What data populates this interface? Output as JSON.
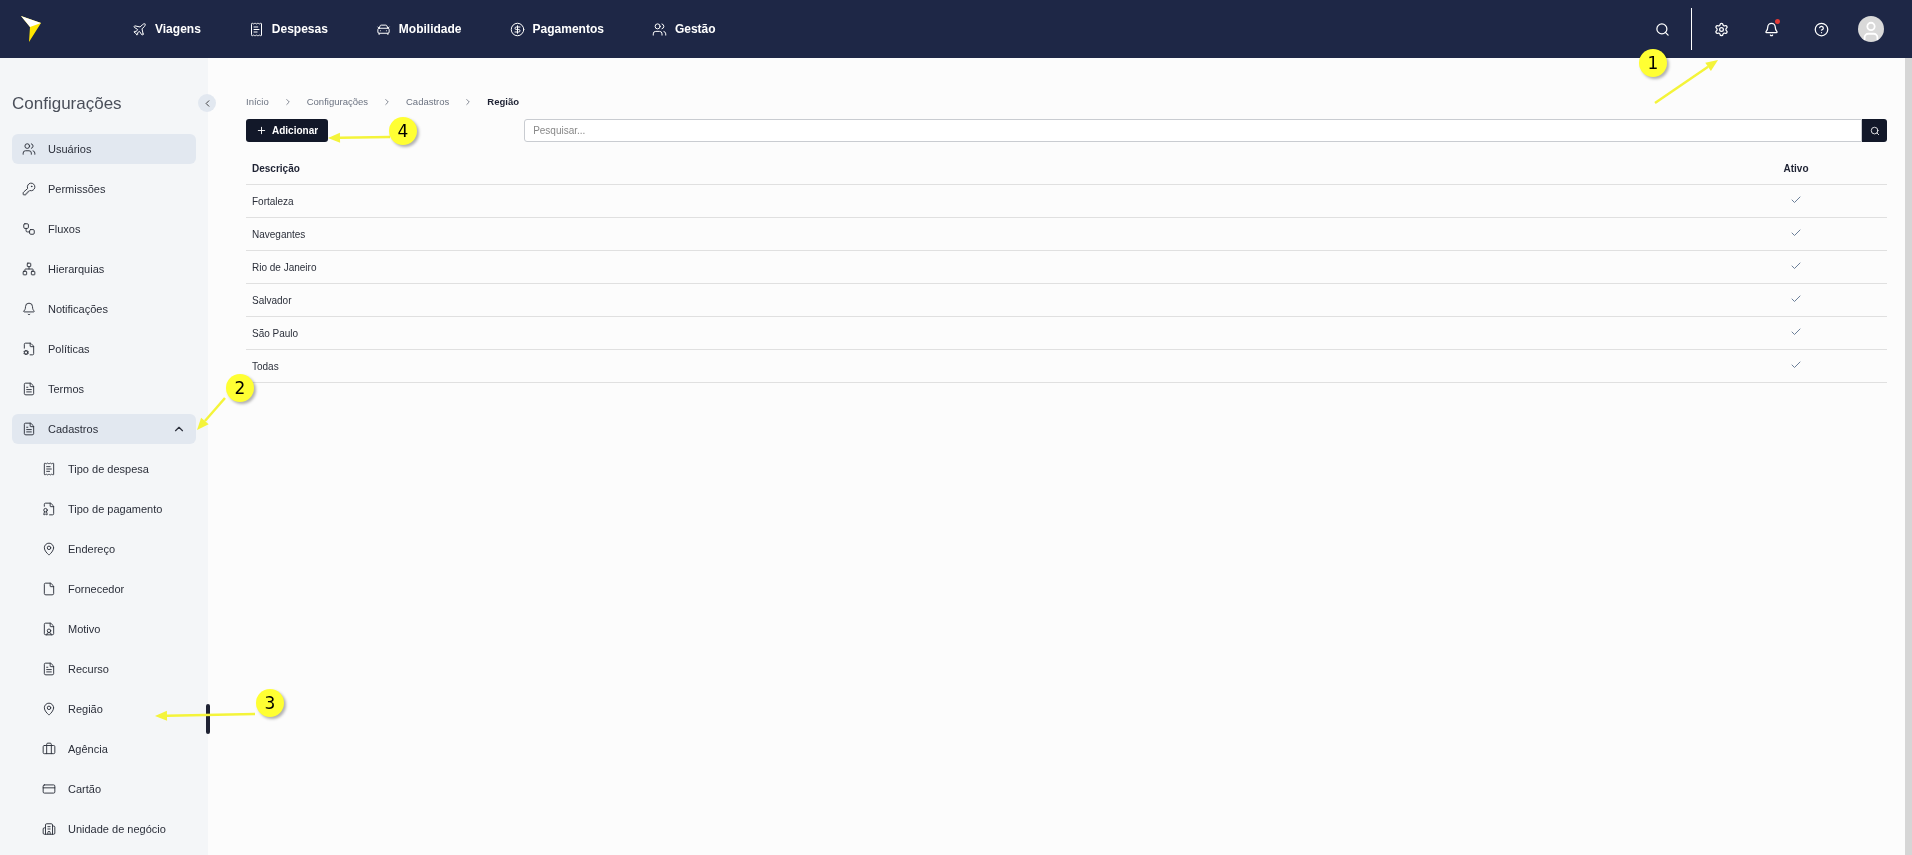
{
  "topbar": {
    "nav": [
      {
        "label": "Viagens"
      },
      {
        "label": "Despesas"
      },
      {
        "label": "Mobilidade"
      },
      {
        "label": "Pagamentos"
      },
      {
        "label": "Gestão"
      }
    ],
    "notifications_unread": true
  },
  "sidebar": {
    "title": "Configurações",
    "items": [
      {
        "label": "Usuários",
        "selected": true
      },
      {
        "label": "Permissões",
        "selected": false
      },
      {
        "label": "Fluxos",
        "selected": false
      },
      {
        "label": "Hierarquias",
        "selected": false
      },
      {
        "label": "Notificações",
        "selected": false
      },
      {
        "label": "Políticas",
        "selected": false
      },
      {
        "label": "Termos",
        "selected": false
      },
      {
        "label": "Cadastros",
        "selected": true,
        "expanded": true,
        "children": [
          {
            "label": "Tipo de despesa",
            "selected": false
          },
          {
            "label": "Tipo de pagamento",
            "selected": false
          },
          {
            "label": "Endereço",
            "selected": false
          },
          {
            "label": "Fornecedor",
            "selected": false
          },
          {
            "label": "Motivo",
            "selected": false
          },
          {
            "label": "Recurso",
            "selected": false
          },
          {
            "label": "Região",
            "selected": false
          },
          {
            "label": "Agência",
            "selected": false
          },
          {
            "label": "Cartão",
            "selected": false
          },
          {
            "label": "Unidade de negócio",
            "selected": false
          }
        ]
      }
    ]
  },
  "breadcrumb": [
    "Início",
    "Configurações",
    "Cadastros",
    "Região"
  ],
  "add_button": "Adicionar",
  "search": {
    "placeholder": "Pesquisar..."
  },
  "table": {
    "columns": [
      "Descrição",
      "Ativo"
    ],
    "rows": [
      {
        "description": "Fortaleza",
        "active": true
      },
      {
        "description": "Navegantes",
        "active": true
      },
      {
        "description": "Rio de Janeiro",
        "active": true
      },
      {
        "description": "Salvador",
        "active": true
      },
      {
        "description": "São Paulo",
        "active": true
      },
      {
        "description": "Todas",
        "active": true
      }
    ]
  },
  "callouts": [
    "1",
    "2",
    "3",
    "4"
  ]
}
